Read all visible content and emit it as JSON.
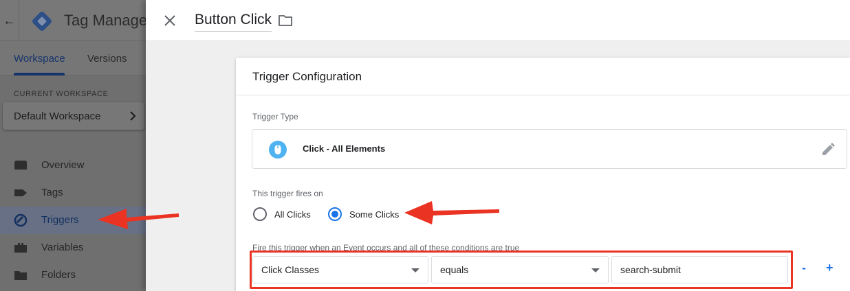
{
  "app": {
    "title": "Tag Manager",
    "logo_icon": "gtm-diamond-icon",
    "brand_color": "#1a73e8"
  },
  "left_nav": {
    "back_icon": "arrow-left-icon",
    "tabs": [
      {
        "label": "Workspace",
        "active": true
      },
      {
        "label": "Versions",
        "active": false
      }
    ],
    "current_workspace_label": "CURRENT WORKSPACE",
    "workspace_name": "Default Workspace",
    "items": [
      {
        "label": "Overview",
        "icon": "overview-icon",
        "active": false
      },
      {
        "label": "Tags",
        "icon": "tag-icon",
        "active": false
      },
      {
        "label": "Triggers",
        "icon": "trigger-icon",
        "active": true
      },
      {
        "label": "Variables",
        "icon": "variables-icon",
        "active": false
      },
      {
        "label": "Folders",
        "icon": "folder-icon",
        "active": false
      }
    ]
  },
  "panel": {
    "name": "Button Click",
    "close_icon": "close-icon",
    "folder_icon": "folder-outline-icon"
  },
  "trigger_config": {
    "title": "Trigger Configuration",
    "type_label": "Trigger Type",
    "type_name": "Click - All Elements",
    "type_icon": "mouse-icon",
    "fires_on_label": "This trigger fires on",
    "options": [
      {
        "label": "All Clicks",
        "selected": false
      },
      {
        "label": "Some Clicks",
        "selected": true
      }
    ],
    "condition_label": "Fire this trigger when an Event occurs and all of these conditions are true",
    "condition": {
      "variable": "Click Classes",
      "operator": "equals",
      "value": "search-submit"
    },
    "remove_label": "-",
    "add_label": "+"
  },
  "annotations": {
    "color": "#ea3323"
  }
}
